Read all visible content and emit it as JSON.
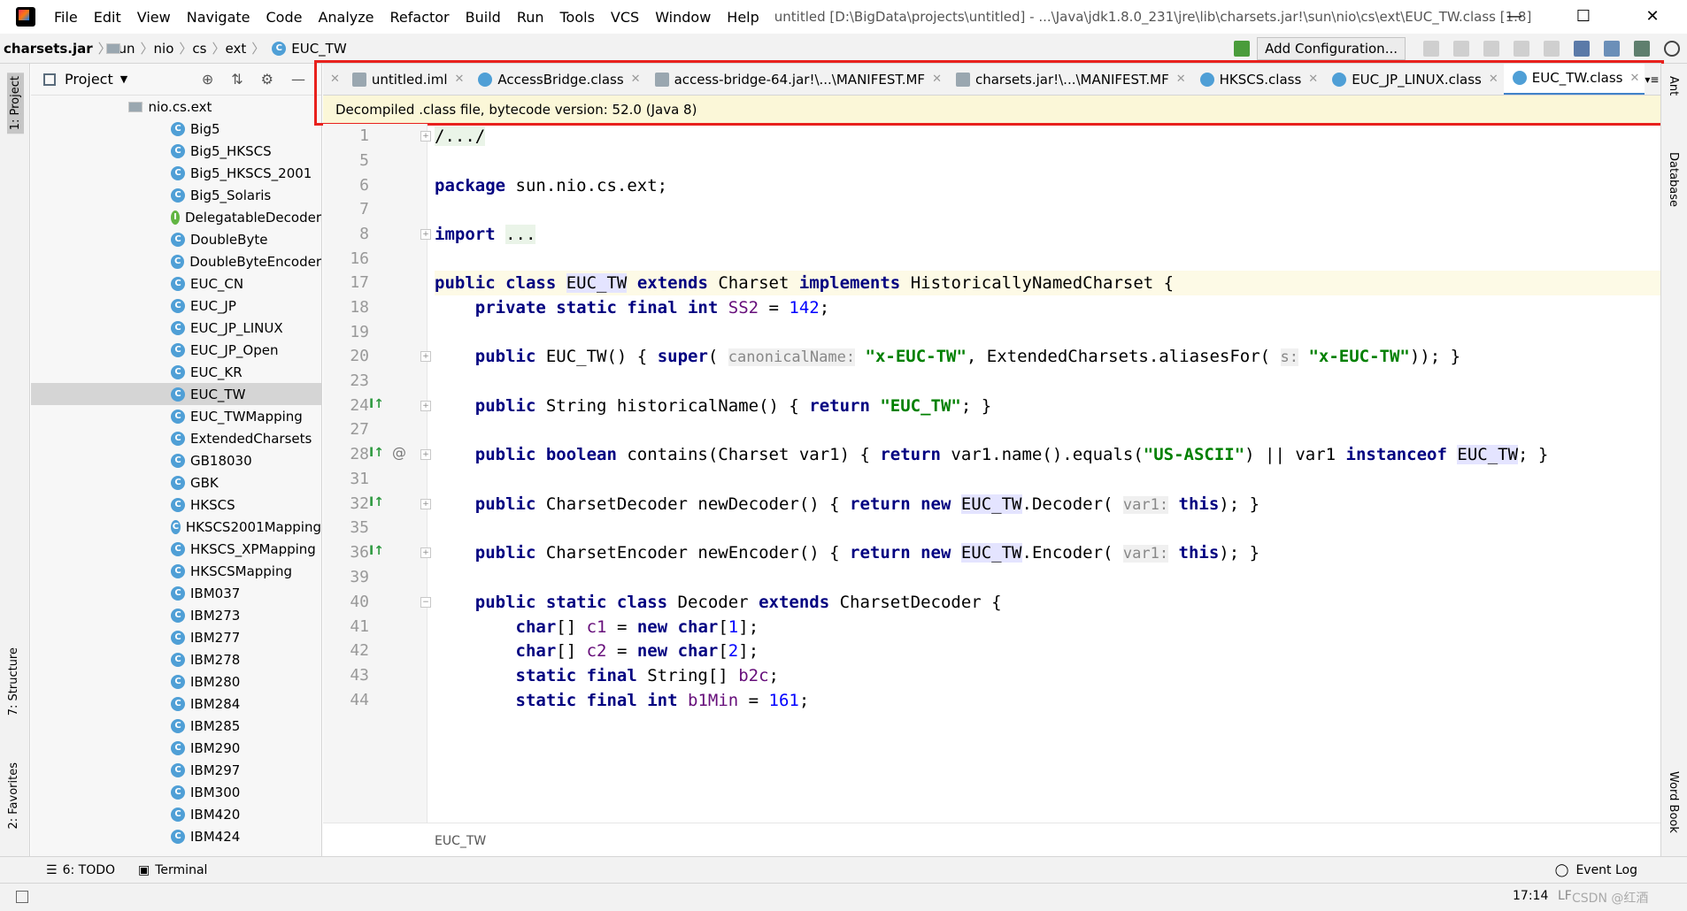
{
  "menu": [
    "File",
    "Edit",
    "View",
    "Navigate",
    "Code",
    "Analyze",
    "Refactor",
    "Build",
    "Run",
    "Tools",
    "VCS",
    "Window",
    "Help"
  ],
  "window_title": "untitled [D:\\BigData\\projects\\untitled] - ...\\Java\\jdk1.8.0_231\\jre\\lib\\charsets.jar!\\sun\\nio\\cs\\ext\\EUC_TW.class [1.8]",
  "breadcrumbs": [
    "charsets.jar",
    "sun",
    "nio",
    "cs",
    "ext",
    "EUC_TW"
  ],
  "add_configuration": "Add Configuration...",
  "left_strip": {
    "project": "1: Project",
    "structure": "7: Structure",
    "favorites": "2: Favorites"
  },
  "right_strip": {
    "ant": "Ant",
    "database": "Database",
    "word_book": "Word Book"
  },
  "project_panel": {
    "title": "Project",
    "root": "nio.cs.ext",
    "items": [
      {
        "label": "Big5",
        "kind": "c"
      },
      {
        "label": "Big5_HKSCS",
        "kind": "c"
      },
      {
        "label": "Big5_HKSCS_2001",
        "kind": "c"
      },
      {
        "label": "Big5_Solaris",
        "kind": "c"
      },
      {
        "label": "DelegatableDecoder",
        "kind": "i"
      },
      {
        "label": "DoubleByte",
        "kind": "c"
      },
      {
        "label": "DoubleByteEncoder",
        "kind": "c"
      },
      {
        "label": "EUC_CN",
        "kind": "c"
      },
      {
        "label": "EUC_JP",
        "kind": "c"
      },
      {
        "label": "EUC_JP_LINUX",
        "kind": "c"
      },
      {
        "label": "EUC_JP_Open",
        "kind": "c"
      },
      {
        "label": "EUC_KR",
        "kind": "c"
      },
      {
        "label": "EUC_TW",
        "kind": "c",
        "selected": true
      },
      {
        "label": "EUC_TWMapping",
        "kind": "c"
      },
      {
        "label": "ExtendedCharsets",
        "kind": "c"
      },
      {
        "label": "GB18030",
        "kind": "c"
      },
      {
        "label": "GBK",
        "kind": "c"
      },
      {
        "label": "HKSCS",
        "kind": "c"
      },
      {
        "label": "HKSCS2001Mapping",
        "kind": "c"
      },
      {
        "label": "HKSCS_XPMapping",
        "kind": "c"
      },
      {
        "label": "HKSCSMapping",
        "kind": "c"
      },
      {
        "label": "IBM037",
        "kind": "c"
      },
      {
        "label": "IBM273",
        "kind": "c"
      },
      {
        "label": "IBM277",
        "kind": "c"
      },
      {
        "label": "IBM278",
        "kind": "c"
      },
      {
        "label": "IBM280",
        "kind": "c"
      },
      {
        "label": "IBM284",
        "kind": "c"
      },
      {
        "label": "IBM285",
        "kind": "c"
      },
      {
        "label": "IBM290",
        "kind": "c"
      },
      {
        "label": "IBM297",
        "kind": "c"
      },
      {
        "label": "IBM300",
        "kind": "c"
      },
      {
        "label": "IBM420",
        "kind": "c"
      },
      {
        "label": "IBM424",
        "kind": "c"
      }
    ]
  },
  "tabs": [
    {
      "label": "untitled.iml",
      "icon": "file"
    },
    {
      "label": "AccessBridge.class",
      "icon": "class"
    },
    {
      "label": "access-bridge-64.jar!\\...\\MANIFEST.MF",
      "icon": "file"
    },
    {
      "label": "charsets.jar!\\...\\MANIFEST.MF",
      "icon": "file"
    },
    {
      "label": "HKSCS.class",
      "icon": "class"
    },
    {
      "label": "EUC_JP_LINUX.class",
      "icon": "class"
    },
    {
      "label": "EUC_TW.class",
      "icon": "class",
      "active": true
    }
  ],
  "tab_overflow": "2",
  "banner": "Decompiled .class file, bytecode version: 52.0 (Java 8)",
  "line_numbers": [
    "1",
    "5",
    "6",
    "7",
    "8",
    "16",
    "17",
    "18",
    "19",
    "20",
    "23",
    "24",
    "27",
    "28",
    "31",
    "32",
    "35",
    "36",
    "39",
    "40",
    "41",
    "42",
    "43",
    "44"
  ],
  "editor_footer": "EUC_TW",
  "toolwindows": {
    "todo": "6: TODO",
    "terminal": "Terminal",
    "event_log": "Event Log"
  },
  "status": {
    "position": "17:14",
    "line_sep": "LF",
    "watermark": "CSDN @红酒"
  },
  "colors": {
    "keyword": "#000080",
    "string": "#008000",
    "number": "#0000ff",
    "highlight": "#e8211d",
    "active_tab": "#4083c9"
  }
}
